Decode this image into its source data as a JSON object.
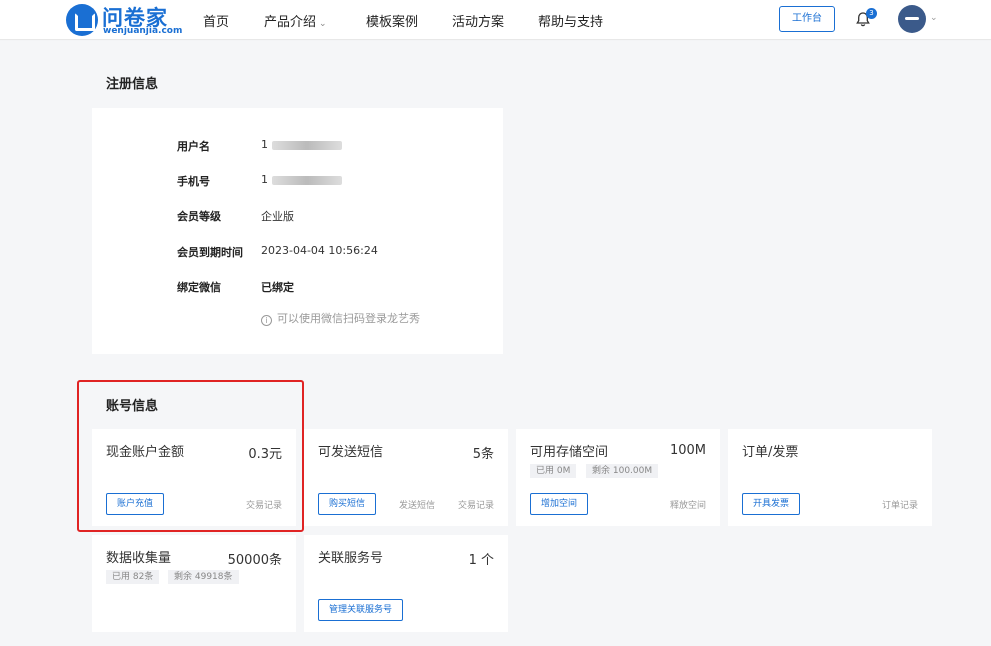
{
  "brand": {
    "name": "问卷家",
    "domain": "wenjuanjia.com",
    "color": "#1a6fd3"
  },
  "nav": {
    "items": [
      {
        "label": "首页"
      },
      {
        "label": "产品介绍",
        "has_dropdown": true
      },
      {
        "label": "模板案例"
      },
      {
        "label": "活动方案"
      },
      {
        "label": "帮助与支持"
      }
    ],
    "workbench_label": "工作台",
    "notification_count": "3"
  },
  "registration": {
    "title": "注册信息",
    "rows": [
      {
        "label": "用户名",
        "value": "1"
      },
      {
        "label": "手机号",
        "value": "1"
      },
      {
        "label": "会员等级",
        "value": "企业版"
      },
      {
        "label": "会员到期时间",
        "value": "2023-04-04 10:56:24"
      },
      {
        "label": "绑定微信",
        "value": "已绑定"
      }
    ],
    "wechat_hint": "可以使用微信扫码登录龙艺秀"
  },
  "account": {
    "title": "账号信息",
    "highlight_color": "#e02424",
    "cards": [
      {
        "title": "现金账户金额",
        "value": "0.3元",
        "button": "账户充值",
        "links": [
          "交易记录"
        ]
      },
      {
        "title": "可发送短信",
        "value": "5条",
        "button": "购买短信",
        "links": [
          "发送短信",
          "交易记录"
        ]
      },
      {
        "title": "可用存储空间",
        "value": "100M",
        "tags": [
          "已用 0M",
          "剩余 100.00M"
        ],
        "button": "增加空间",
        "links": [
          "释放空间"
        ]
      },
      {
        "title": "订单/发票",
        "value": "",
        "button": "开具发票",
        "links": [
          "订单记录"
        ]
      },
      {
        "title": "数据收集量",
        "value": "50000条",
        "tags": [
          "已用 82条",
          "剩余 49918条"
        ]
      },
      {
        "title": "关联服务号",
        "value": "1 个",
        "button": "管理关联服务号"
      }
    ]
  }
}
